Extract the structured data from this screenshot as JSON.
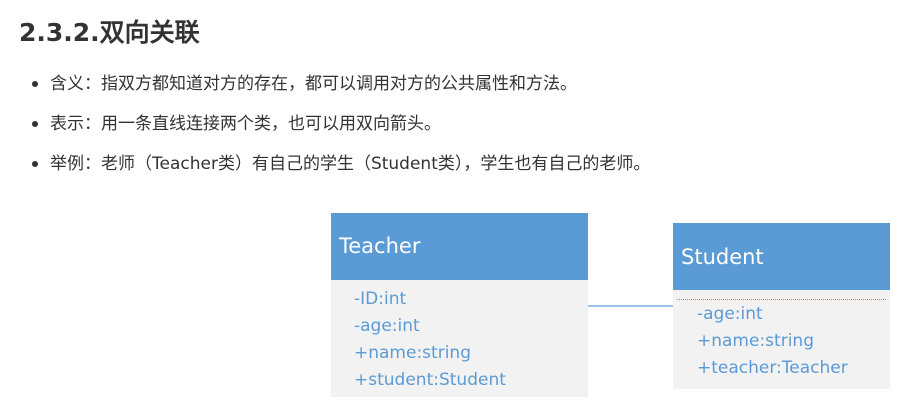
{
  "heading": "2.3.2.双向关联",
  "bullets": [
    "含义：指双方都知道对方的存在，都可以调用对方的公共属性和方法。",
    "表示：用一条直线连接两个类，也可以用双向箭头。",
    "举例：老师（Teacher类）有自己的学生（Student类），学生也有自己的老师。"
  ],
  "diagram": {
    "teacher": {
      "name": "Teacher",
      "attributes": [
        "-ID:int",
        "-age:int",
        "+name:string",
        "+student:Student"
      ]
    },
    "student": {
      "name": "Student",
      "attributes": [
        "-age:int",
        "+name:string",
        "+teacher:Teacher"
      ]
    },
    "colors": {
      "header_fill": "#5b9bd5",
      "body_fill": "#f2f2f2",
      "attribute_text": "#5b9bd5",
      "association_line": "#9dc3e6"
    }
  }
}
